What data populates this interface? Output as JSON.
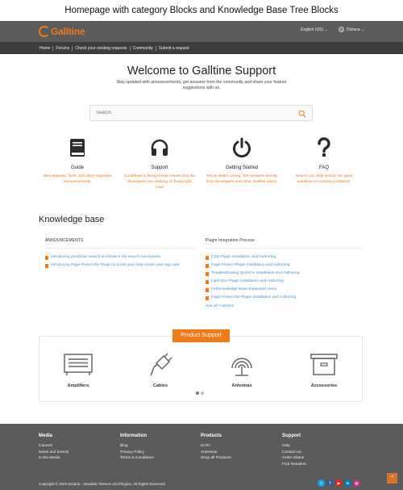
{
  "caption": "Homepage with category Blocks and Knowledge Base Tree Blocks",
  "header": {
    "logo_text": "Galltine",
    "language": "English (US) ⌄",
    "user": "Diziana ⌄"
  },
  "nav": [
    "Home",
    "Forums",
    "Check your existing requests",
    "Community",
    "Submit a request"
  ],
  "hero": {
    "title": "Welcome to Galltine Support",
    "subtitle": "Stay updated with announcements, get answers from the community and share your feature suggestions with us."
  },
  "search": {
    "placeholder": "Search"
  },
  "categories": [
    {
      "title": "Guide",
      "desc": "New features, fixes, and other important announcements.",
      "icon": "book-icon"
    },
    {
      "title": "Support",
      "desc": "Contribute to fixing Known issues that the developers are working on fixing right now!",
      "icon": "headphones-icon"
    },
    {
      "title": "Getting Started",
      "desc": "Tell us what's wrong. Get answers directly from developers and other Galltine users.",
      "icon": "power-icon"
    },
    {
      "title": "FAQ",
      "desc": "Search our Help section for quick solutions to common problems.",
      "icon": "question-icon"
    }
  ],
  "kb": {
    "title": "Knowledge base",
    "left": {
      "heading": "ANNOUNCEMENTS",
      "items": [
        "Introducing predictive search to enhance the search mechanism.",
        "Introducing Page Protect lite Plugin to boost your help center user sign-ups"
      ]
    },
    "right": {
      "heading": "Plugin Integration Process",
      "items": [
        "CSH Plugin Installation and Authoring",
        "Page Protect Plugin Installation and Authoring",
        "Troubleshooting QuickFix Installation and Authoring",
        "Light Box Plugin Installation and Authoring",
        "Full Knowledge Base Expanded menu",
        "Page Protect-lite Plugin Installation and Authoring"
      ],
      "see_all": "See all 7 articles"
    }
  },
  "products": {
    "button": "Product Support",
    "items": [
      {
        "label": "Amplifiers",
        "icon": "amplifier-icon"
      },
      {
        "label": "Cables",
        "icon": "plug-icon"
      },
      {
        "label": "Antennas",
        "icon": "antenna-icon"
      },
      {
        "label": "Accessories",
        "icon": "box-icon"
      }
    ]
  },
  "footer": {
    "columns": [
      {
        "heading": "Media",
        "links": [
          "Careers",
          "News and Events",
          "In the Media"
        ]
      },
      {
        "heading": "Information",
        "links": [
          "Blog",
          "Privacy Policy",
          "Terms & Conditions"
        ]
      },
      {
        "heading": "Products",
        "links": [
          "DVR+",
          "Antennas",
          "Shop all Products"
        ]
      },
      {
        "heading": "Support",
        "links": [
          "Help",
          "Contact Us",
          "Order Status",
          "Find Retailers"
        ]
      }
    ],
    "copyright": "Copyright © 2020 Diziana - Zendesk Themes and Plugins. All Rights Reserved",
    "social": [
      {
        "glyph": "t",
        "icon": "twitter-icon",
        "color": "#1da1f2"
      },
      {
        "glyph": "f",
        "icon": "facebook-icon",
        "color": "#3b5998"
      },
      {
        "glyph": "▶",
        "icon": "youtube-icon",
        "color": "#e62117"
      },
      {
        "glyph": "in",
        "icon": "linkedin-icon",
        "color": "#0077b5"
      },
      {
        "glyph": "◎",
        "icon": "instagram-icon",
        "color": "#c13584"
      }
    ],
    "back_to_top": "^"
  },
  "colors": {
    "accent": "#f07a1a",
    "link": "#4a90c8",
    "header_bg": "#5b5b5b",
    "nav_bg": "#3d3d3d"
  }
}
